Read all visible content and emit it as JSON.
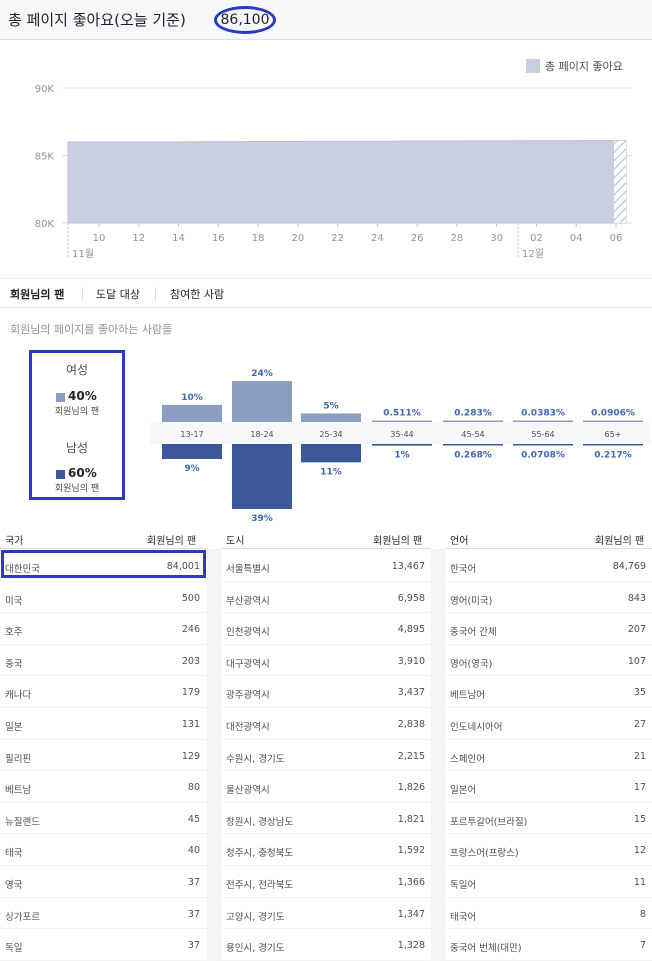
{
  "header": {
    "title": "총 페이지 좋아요(오늘 기준)",
    "count": "86,100"
  },
  "chart_data": [
    {
      "type": "area",
      "legend": "총 페이지 좋아요",
      "legend_position": "top-right",
      "y_ticks": [
        "90K",
        "85K",
        "80K"
      ],
      "ylim": [
        80000,
        90000
      ],
      "x_ticks": [
        "10",
        "12",
        "14",
        "16",
        "18",
        "20",
        "22",
        "24",
        "26",
        "28",
        "30",
        "02",
        "04",
        "06"
      ],
      "month_labels": [
        "11월",
        "12월"
      ],
      "x": [
        "11-09",
        "11-10",
        "11-11",
        "11-12",
        "11-13",
        "11-14",
        "11-15",
        "11-16",
        "11-17",
        "11-18",
        "11-19",
        "11-20",
        "11-21",
        "11-22",
        "11-23",
        "11-24",
        "11-25",
        "11-26",
        "11-27",
        "11-28",
        "11-29",
        "11-30",
        "12-01",
        "12-02",
        "12-03",
        "12-04",
        "12-05",
        "12-06",
        "12-07"
      ],
      "values": [
        86000,
        86000,
        86000,
        86000,
        86000,
        86000,
        86010,
        86020,
        86020,
        86030,
        86040,
        86040,
        86050,
        86050,
        86060,
        86060,
        86060,
        86070,
        86070,
        86070,
        86080,
        86080,
        86080,
        86090,
        86090,
        86090,
        86100,
        86100,
        86100
      ],
      "color": "#c7cfe0",
      "grid": true
    },
    {
      "type": "bar",
      "categories": [
        "13-17",
        "18-24",
        "25-34",
        "35-44",
        "45-54",
        "55-64",
        "65+"
      ],
      "series": [
        {
          "name": "여성",
          "values": [
            10,
            24,
            5,
            0.511,
            0.283,
            0.0383,
            0.0906
          ],
          "labels": [
            "10%",
            "24%",
            "5%",
            "0.511%",
            "0.283%",
            "0.0383%",
            "0.0906%"
          ],
          "color": "#8b9dc3"
        },
        {
          "name": "남성",
          "values": [
            9,
            39,
            11,
            1,
            0.268,
            0.0708,
            0.217
          ],
          "labels": [
            "9%",
            "39%",
            "11%",
            "1%",
            "0.268%",
            "0.0708%",
            "0.217%"
          ],
          "color": "#3b5998"
        }
      ]
    }
  ],
  "tabs": [
    "회원님의 팬",
    "도달 대상",
    "참여한 사람"
  ],
  "section_title": "회원님의 페이지를 좋아하는 사람들",
  "gender": {
    "female": {
      "label": "여성",
      "pct": "40%",
      "sub": "회원님의 팬",
      "color": "#8b9dc3"
    },
    "male": {
      "label": "남성",
      "pct": "60%",
      "sub": "회원님의 팬",
      "color": "#3b5998"
    }
  },
  "tables": {
    "country": {
      "headers": [
        "국가",
        "회원님의 팬"
      ],
      "rows": [
        [
          "대한민국",
          "84,001"
        ],
        [
          "미국",
          "500"
        ],
        [
          "호주",
          "246"
        ],
        [
          "중국",
          "203"
        ],
        [
          "캐나다",
          "179"
        ],
        [
          "일본",
          "131"
        ],
        [
          "필리핀",
          "129"
        ],
        [
          "베트남",
          "80"
        ],
        [
          "뉴질랜드",
          "45"
        ],
        [
          "태국",
          "40"
        ],
        [
          "영국",
          "37"
        ],
        [
          "싱가포르",
          "37"
        ],
        [
          "독일",
          "37"
        ]
      ]
    },
    "city": {
      "headers": [
        "도시",
        "회원님의 팬"
      ],
      "rows": [
        [
          "서울특별시",
          "13,467"
        ],
        [
          "부산광역시",
          "6,958"
        ],
        [
          "인천광역시",
          "4,895"
        ],
        [
          "대구광역시",
          "3,910"
        ],
        [
          "광주광역시",
          "3,437"
        ],
        [
          "대전광역시",
          "2,838"
        ],
        [
          "수원시, 경기도",
          "2,215"
        ],
        [
          "울산광역시",
          "1,826"
        ],
        [
          "창원시, 경상남도",
          "1,821"
        ],
        [
          "청주시, 충청북도",
          "1,592"
        ],
        [
          "전주시, 전라북도",
          "1,366"
        ],
        [
          "고양시, 경기도",
          "1,347"
        ],
        [
          "용인시, 경기도",
          "1,328"
        ]
      ]
    },
    "language": {
      "headers": [
        "언어",
        "회원님의 팬"
      ],
      "rows": [
        [
          "한국어",
          "84,769"
        ],
        [
          "영어(미국)",
          "843"
        ],
        [
          "중국어 간체",
          "207"
        ],
        [
          "영어(영국)",
          "107"
        ],
        [
          "베트남어",
          "35"
        ],
        [
          "인도네시아어",
          "27"
        ],
        [
          "스페인어",
          "21"
        ],
        [
          "일본어",
          "17"
        ],
        [
          "포르투갈어(브라질)",
          "15"
        ],
        [
          "프랑스어(프랑스)",
          "12"
        ],
        [
          "독일어",
          "11"
        ],
        [
          "태국어",
          "8"
        ],
        [
          "중국어 번체(대만)",
          "7"
        ]
      ]
    }
  }
}
